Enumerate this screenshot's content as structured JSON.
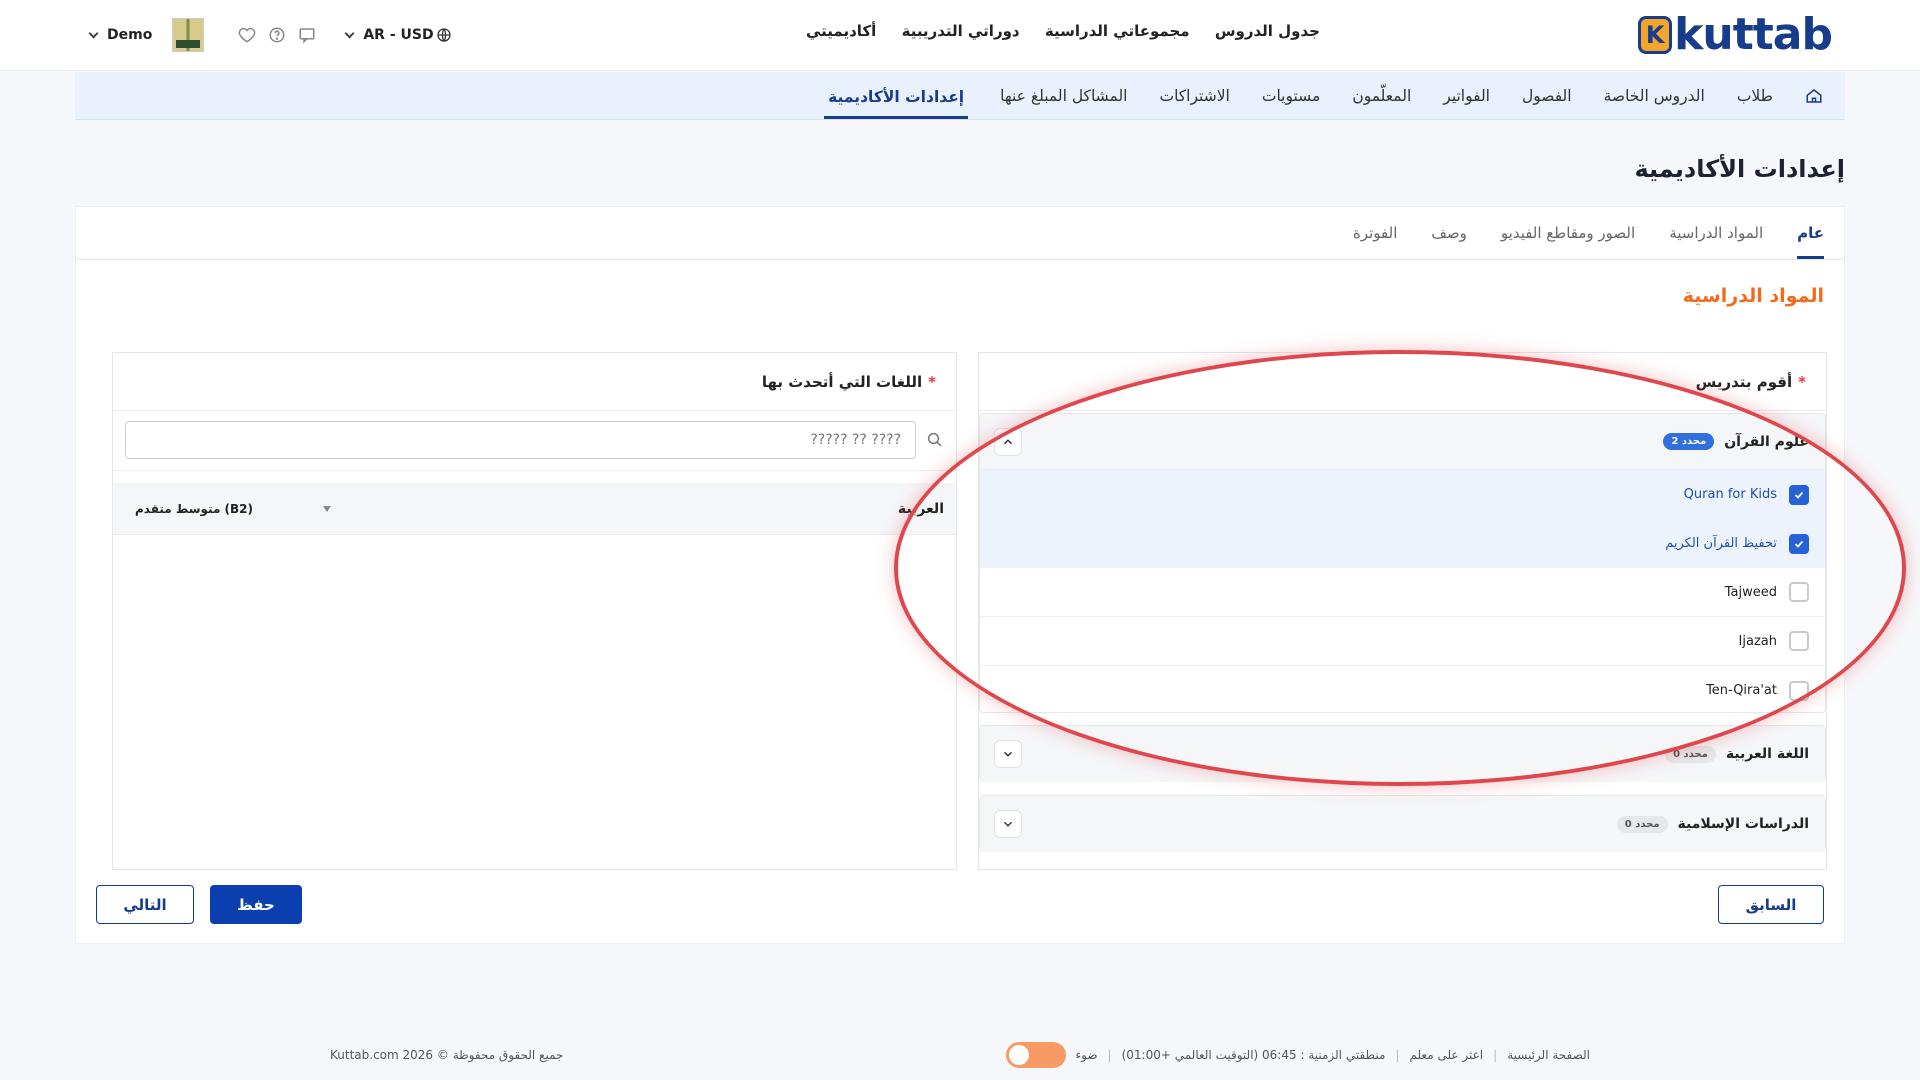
{
  "brand": {
    "logo_text": "kuttab",
    "logo_mark": "K"
  },
  "topnav": [
    "جدول الدروس",
    "مجموعاتي الدراسية",
    "دوراتي التدريبية",
    "أكاديميتي"
  ],
  "user": {
    "name": "Demo",
    "currency": "AR - USD"
  },
  "icons": {
    "globe": "globe-icon",
    "chat": "chat-icon",
    "help": "help-icon",
    "heart": "heart-icon"
  },
  "subnav": {
    "items": [
      "طلاب",
      "الدروس الخاصة",
      "الفصول",
      "الفواتير",
      "المعلّمون",
      "مستويات",
      "الاشتراكات",
      "المشاكل المبلغ عنها",
      "إعدادات الأكاديمية"
    ],
    "active": "إعدادات الأكاديمية"
  },
  "page_title": "إعدادات الأكاديمية",
  "tabs": {
    "items": [
      "عام",
      "المواد الدراسية",
      "الصور ومقاطع الفيديو",
      "وصف",
      "الفوترة"
    ],
    "active": "عام"
  },
  "section_title": "المواد الدراسية",
  "teaching": {
    "heading": "أقوم بتدريس",
    "required_mark": "*",
    "groups": [
      {
        "title": "علوم القرآن",
        "badge": "2 محدد",
        "expanded": true,
        "options": [
          {
            "label": "Quran for Kids",
            "checked": true
          },
          {
            "label": "تحفيظ القرآن الكريم",
            "checked": true
          },
          {
            "label": "Tajweed",
            "checked": false
          },
          {
            "label": "Ijazah",
            "checked": false
          },
          {
            "label": "Ten-Qira'at",
            "checked": false
          }
        ]
      },
      {
        "title": "اللغة العربية",
        "badge": "0 محدد",
        "expanded": false
      },
      {
        "title": "الدراسات الإسلامية",
        "badge": "0 محدد",
        "expanded": false
      }
    ]
  },
  "languages": {
    "heading": "اللغات التي أتحدث بها",
    "required_mark": "*",
    "search_placeholder": "????? ?? ????",
    "rows": [
      {
        "language": "العربية",
        "level": "متوسط متقدم (B2)"
      }
    ]
  },
  "buttons": {
    "previous": "السابق",
    "save": "حفظ",
    "next": "التالي"
  },
  "footer": {
    "home": "الصفحة الرئيسية",
    "find_teacher": "اعثر على معلم",
    "timezone": "منطقتي الزمنية : 06:45 (التوقيت العالمي +01:00)",
    "light": "ضوء",
    "copyright": "Kuttab.com 2026 © جميع الحقوق محفوظة"
  },
  "colors": {
    "brand": "#173c8c",
    "accent": "#f26b1d",
    "primary_button": "#0b3fb0",
    "annotation": "#e0474c"
  }
}
